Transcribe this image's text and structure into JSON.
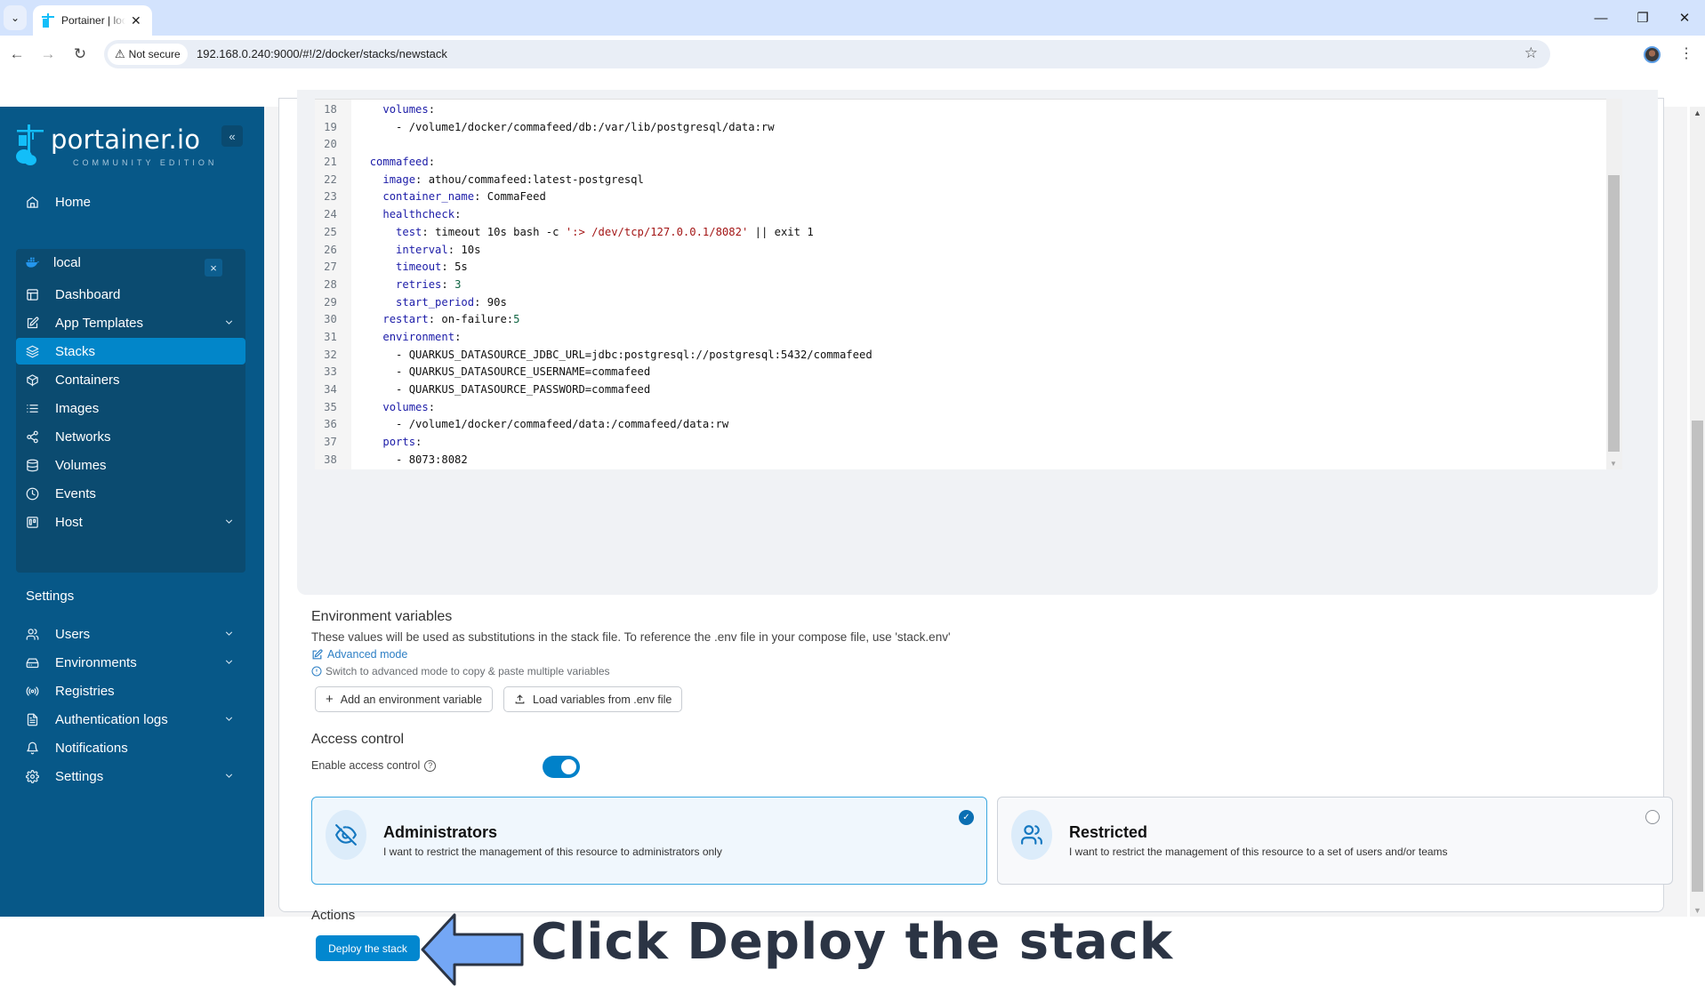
{
  "browser": {
    "tab_title": "Portainer | local",
    "security_label": "Not secure",
    "url": "192.168.0.240:9000/#!/2/docker/stacks/newstack"
  },
  "sidebar": {
    "logo_text": "portainer.io",
    "logo_subtitle": "COMMUNITY EDITION",
    "home": {
      "label": "Home",
      "icon": "home-icon"
    },
    "environment": {
      "name": "local",
      "icon": "docker-icon",
      "items": [
        {
          "label": "Dashboard",
          "icon": "dashboard-icon",
          "expandable": false,
          "active": false
        },
        {
          "label": "App Templates",
          "icon": "edit-icon",
          "expandable": true,
          "active": false
        },
        {
          "label": "Stacks",
          "icon": "layers-icon",
          "expandable": false,
          "active": true
        },
        {
          "label": "Containers",
          "icon": "box-icon",
          "expandable": false,
          "active": false
        },
        {
          "label": "Images",
          "icon": "list-icon",
          "expandable": false,
          "active": false
        },
        {
          "label": "Networks",
          "icon": "share-icon",
          "expandable": false,
          "active": false
        },
        {
          "label": "Volumes",
          "icon": "database-icon",
          "expandable": false,
          "active": false
        },
        {
          "label": "Events",
          "icon": "clock-icon",
          "expandable": false,
          "active": false
        },
        {
          "label": "Host",
          "icon": "trello-icon",
          "expandable": true,
          "active": false
        }
      ]
    },
    "settings_heading": "Settings",
    "settings_items": [
      {
        "label": "Users",
        "icon": "users-icon",
        "expandable": true
      },
      {
        "label": "Environments",
        "icon": "hard-drive-icon",
        "expandable": true
      },
      {
        "label": "Registries",
        "icon": "radio-icon",
        "expandable": false
      },
      {
        "label": "Authentication logs",
        "icon": "file-text-icon",
        "expandable": true
      },
      {
        "label": "Notifications",
        "icon": "bell-icon",
        "expandable": false
      },
      {
        "label": "Settings",
        "icon": "settings-icon",
        "expandable": true
      }
    ]
  },
  "editor": {
    "lines": [
      {
        "n": "18",
        "tokens": [
          [
            "    ",
            ""
          ],
          [
            "volumes",
            "k"
          ],
          [
            ":",
            "v"
          ]
        ]
      },
      {
        "n": "19",
        "tokens": [
          [
            "      - /volume1/docker/commafeed/db:/var/lib/postgresql/data:rw",
            "v"
          ]
        ]
      },
      {
        "n": "20",
        "tokens": []
      },
      {
        "n": "21",
        "tokens": [
          [
            "  ",
            ""
          ],
          [
            "commafeed",
            "k"
          ],
          [
            ":",
            "v"
          ]
        ]
      },
      {
        "n": "22",
        "tokens": [
          [
            "    ",
            ""
          ],
          [
            "image",
            "k"
          ],
          [
            ": athou/commafeed:latest-postgresql",
            "v"
          ]
        ]
      },
      {
        "n": "23",
        "tokens": [
          [
            "    ",
            ""
          ],
          [
            "container_name",
            "k"
          ],
          [
            ": CommaFeed",
            "v"
          ]
        ]
      },
      {
        "n": "24",
        "tokens": [
          [
            "    ",
            ""
          ],
          [
            "healthcheck",
            "k"
          ],
          [
            ":",
            "v"
          ]
        ]
      },
      {
        "n": "25",
        "tokens": [
          [
            "      ",
            ""
          ],
          [
            "test",
            "k"
          ],
          [
            ": timeout 10s bash -c ",
            "v"
          ],
          [
            "':> /dev/tcp/127.0.0.1/8082'",
            "s"
          ],
          [
            " || exit 1",
            "v"
          ]
        ]
      },
      {
        "n": "26",
        "tokens": [
          [
            "      ",
            ""
          ],
          [
            "interval",
            "k"
          ],
          [
            ": 10s",
            "v"
          ]
        ]
      },
      {
        "n": "27",
        "tokens": [
          [
            "      ",
            ""
          ],
          [
            "timeout",
            "k"
          ],
          [
            ": 5s",
            "v"
          ]
        ]
      },
      {
        "n": "28",
        "tokens": [
          [
            "      ",
            ""
          ],
          [
            "retries",
            "k"
          ],
          [
            ": ",
            "v"
          ],
          [
            "3",
            "n"
          ]
        ]
      },
      {
        "n": "29",
        "tokens": [
          [
            "      ",
            ""
          ],
          [
            "start_period",
            "k"
          ],
          [
            ": 90s",
            "v"
          ]
        ]
      },
      {
        "n": "30",
        "tokens": [
          [
            "    ",
            ""
          ],
          [
            "restart",
            "k"
          ],
          [
            ": on-failure:",
            "v"
          ],
          [
            "5",
            "n"
          ]
        ]
      },
      {
        "n": "31",
        "tokens": [
          [
            "    ",
            ""
          ],
          [
            "environment",
            "k"
          ],
          [
            ":",
            "v"
          ]
        ]
      },
      {
        "n": "32",
        "tokens": [
          [
            "      - QUARKUS_DATASOURCE_JDBC_URL=jdbc:postgresql://postgresql:5432/commafeed",
            "v"
          ]
        ]
      },
      {
        "n": "33",
        "tokens": [
          [
            "      - QUARKUS_DATASOURCE_USERNAME=commafeed",
            "v"
          ]
        ]
      },
      {
        "n": "34",
        "tokens": [
          [
            "      - QUARKUS_DATASOURCE_PASSWORD=commafeed",
            "v"
          ]
        ]
      },
      {
        "n": "35",
        "tokens": [
          [
            "    ",
            ""
          ],
          [
            "volumes",
            "k"
          ],
          [
            ":",
            "v"
          ]
        ]
      },
      {
        "n": "36",
        "tokens": [
          [
            "      - /volume1/docker/commafeed/data:/commafeed/data:rw",
            "v"
          ]
        ]
      },
      {
        "n": "37",
        "tokens": [
          [
            "    ",
            ""
          ],
          [
            "ports",
            "k"
          ],
          [
            ":",
            "v"
          ]
        ]
      },
      {
        "n": "38",
        "tokens": [
          [
            "      - 8073:8082",
            "v"
          ]
        ]
      }
    ]
  },
  "env_vars": {
    "title": "Environment variables",
    "description": "These values will be used as substitutions in the stack file. To reference the .env file in your compose file, use 'stack.env'",
    "advanced_mode_label": "Advanced mode",
    "hint": "Switch to advanced mode to copy & paste multiple variables",
    "add_button": "Add an environment variable",
    "load_button": "Load variables from .env file"
  },
  "access_control": {
    "title": "Access control",
    "enable_label": "Enable access control",
    "enabled": true,
    "options": [
      {
        "title": "Administrators",
        "description": "I want to restrict the management of this resource to administrators only",
        "selected": true
      },
      {
        "title": "Restricted",
        "description": "I want to restrict the management of this resource to a set of users and/or teams",
        "selected": false
      }
    ]
  },
  "actions": {
    "title": "Actions",
    "deploy_button": "Deploy the stack"
  },
  "annotation": {
    "text": "Click Deploy the stack",
    "arrow_color": "#74a7f5"
  },
  "colors": {
    "sidebar_bg": "#075888",
    "accent": "#0287cf"
  }
}
